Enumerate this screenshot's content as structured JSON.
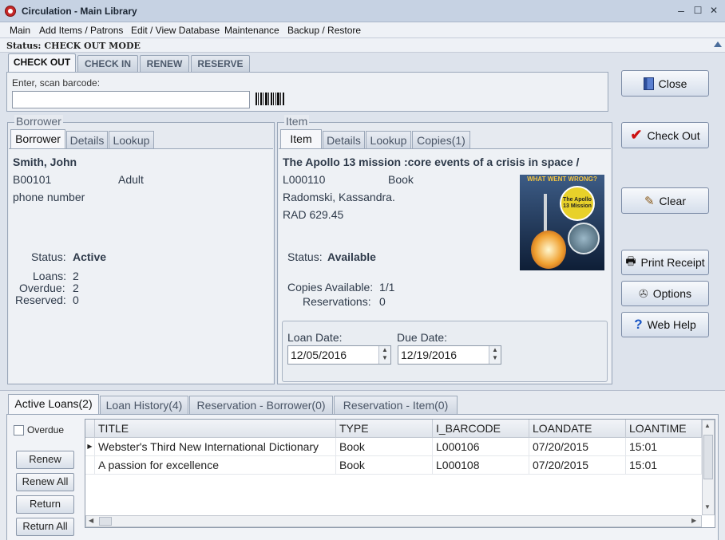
{
  "window": {
    "title": "Circulation - Main Library",
    "minimize": "‒",
    "maximize": "☐",
    "close": "✕"
  },
  "menu": [
    "Main",
    "Add Items / Patrons",
    "Edit / View Database",
    "Maintenance",
    "Backup / Restore"
  ],
  "status": "Status: CHECK OUT MODE",
  "mode_tabs": [
    "CHECK OUT",
    "CHECK IN",
    "RENEW",
    "RESERVE"
  ],
  "scan": {
    "label": "Enter, scan barcode:",
    "value": ""
  },
  "buttons": {
    "close": "Close",
    "checkout": "Check Out",
    "clear": "Clear",
    "print": "Print Receipt",
    "options": "Options",
    "help": "Web Help"
  },
  "borrower": {
    "group": "Borrower",
    "tabs": [
      "Borrower",
      "Details",
      "Lookup"
    ],
    "name": "Smith, John",
    "id": "B00101",
    "type": "Adult",
    "phone": "phone number",
    "status_label": "Status:",
    "status": "Active",
    "loans_label": "Loans:",
    "loans": "2",
    "overdue_label": "Overdue:",
    "overdue": "2",
    "reserved_label": "Reserved:",
    "reserved": "0"
  },
  "item": {
    "group": "Item",
    "tabs": [
      "Item",
      "Details",
      "Lookup",
      "Copies(1)"
    ],
    "title": "The Apollo 13 mission :core events of a crisis in space /",
    "barcode": "L000110",
    "type": "Book",
    "author": "Radomski, Kassandra.",
    "call": "RAD 629.45",
    "status_label": "Status:",
    "status": "Available",
    "copies_label": "Copies Available:",
    "copies": "1/1",
    "res_label": "Reservations:",
    "reservations": "0",
    "loan_date_label": "Loan Date:",
    "loan_date": "12/05/2016",
    "due_date_label": "Due Date:",
    "due_date": "12/19/2016",
    "cover": {
      "top": "WHAT WENT WRONG?",
      "badge": "The Apollo 13 Mission"
    }
  },
  "bottom_tabs": [
    "Active Loans(2)",
    "Loan History(4)",
    "Reservation - Borrower(0)",
    "Reservation - Item(0)"
  ],
  "overdue_check": "Overdue",
  "side_buttons": [
    "Renew",
    "Renew All",
    "Return",
    "Return All"
  ],
  "grid": {
    "columns": [
      "TITLE",
      "TYPE",
      "I_BARCODE",
      "LOANDATE",
      "LOANTIME"
    ],
    "rows": [
      [
        "Webster's Third New International Dictionary",
        "Book",
        "L000106",
        "07/20/2015",
        "15:01"
      ],
      [
        "A passion for excellence",
        "Book",
        "L000108",
        "07/20/2015",
        "15:01"
      ]
    ]
  },
  "colors": {
    "accent": "#4a6d9b",
    "title_bar": "#c6d2e3",
    "check_red": "#cc1111"
  }
}
